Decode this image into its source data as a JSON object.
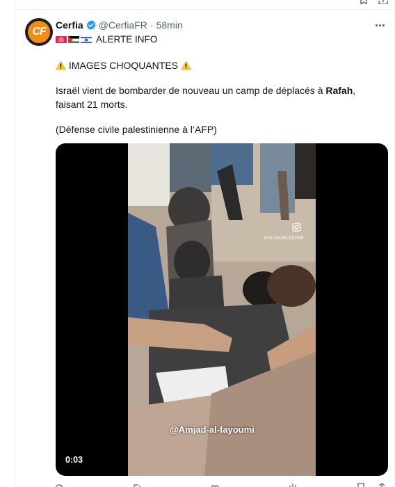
{
  "tweet": {
    "author": {
      "display_name": "Cerfia",
      "handle": "@CerfiaFR",
      "separator": "·",
      "time": "58min",
      "avatar_initials": "CF",
      "verified_icon": "verified-badge-icon"
    },
    "flags_line": {
      "flags": [
        "siren-icon",
        "palestine-flag-icon",
        "israel-flag-icon"
      ],
      "text": "ALERTE INFO"
    },
    "warning_line": "IMAGES CHOQUANTES",
    "body_line_1_prefix": "Israël vient de bombarder de nouveau un camp de déplacés à ",
    "body_line_1_bold": "Rafah",
    "body_line_1_suffix": ",",
    "body_line_2": "faisant 21 morts.",
    "source_line": "(Défense civile palestinienne à l’AFP)",
    "more_icon": "more-horizontal-icon"
  },
  "video": {
    "timecode": "0:03",
    "watermark": "@Amjad-al-fayoumi",
    "instagram_handle": "EYE.ON.PALESTINE",
    "instagram_icon": "instagram-icon"
  },
  "colors": {
    "text_primary": "#0f1419",
    "text_secondary": "#536471",
    "verified_blue": "#1d9bf0",
    "brand_orange": "#f28c18",
    "media_background": "#000000"
  }
}
